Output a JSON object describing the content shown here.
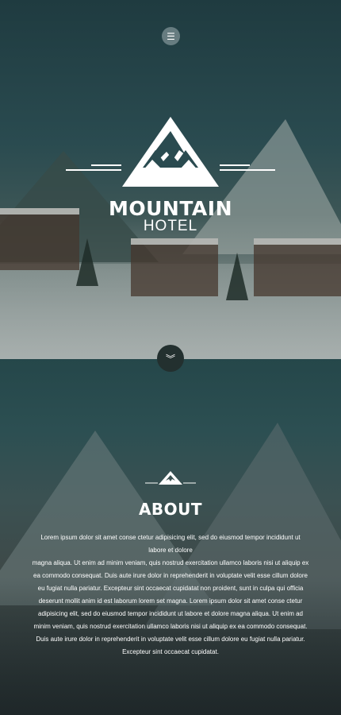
{
  "header": {
    "menu_icon": "hamburger-icon",
    "brand_title": "MOUNTAIN",
    "brand_subtitle": "HOTEL",
    "logo_icon": "mountain-logo-icon",
    "scroll_icon": "chevron-double-down-icon"
  },
  "about": {
    "icon": "mountain-small-icon",
    "title": "ABOUT",
    "paragraph_1": "Lorem ipsum dolor sit amet conse ctetur adipisicing elit, sed do eiusmod tempor incididunt ut labore et dolore",
    "paragraph_2": "magna aliqua. Ut enim ad minim veniam, quis nostrud exercitation ullamco laboris nisi ut aliquip ex ea commodo consequat. Duis aute irure dolor in reprehenderit in voluptate velit esse cillum dolore eu fugiat nulla pariatur. Excepteur sint occaecat cupidatat non proident, sunt in culpa qui officia deserunt mollit anim id est laborum lorem set magna. Lorem ipsum dolor sit amet conse ctetur adipisicing elit, sed do eiusmod tempor incididunt ut labore et dolore magna aliqua. Ut enim ad minim veniam, quis nostrud exercitation ullamco laboris nisi ut aliquip ex ea commodo consequat. Duis aute irure dolor in reprehenderit in voluptate velit esse cillum dolore eu fugiat nulla pariatur. Excepteur sint occaecat cupidatat."
  },
  "colors": {
    "overlay": "#1f3b40",
    "scroll_button": "#23302f",
    "text": "#ffffff"
  }
}
